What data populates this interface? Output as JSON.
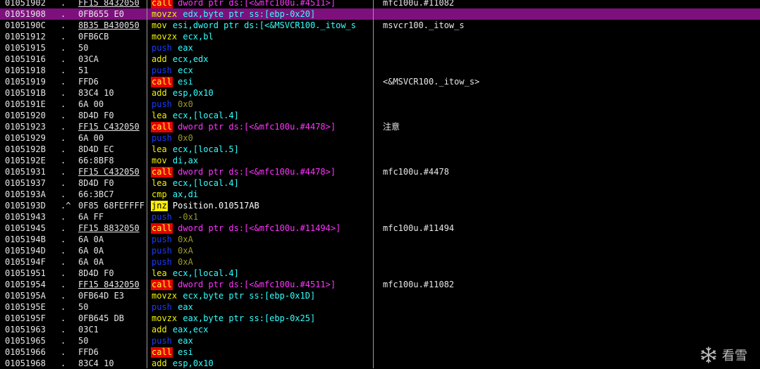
{
  "colors": {
    "background": "#000000",
    "selection": "#7e107e",
    "call_bg": "#e80000",
    "jmp_bg": "#ffee00",
    "push": "#1a3cff",
    "call_operand": "#ff33ff",
    "register_operand": "#33ffff"
  },
  "watermark": {
    "text": "看雪",
    "icon": "snowflake-icon"
  },
  "rows": [
    {
      "addr": "01051902",
      "mark": ".",
      "hex": "FF15 8432050",
      "hex_u": true,
      "mn": "call",
      "op": "dword ptr ds:[<&mfc100u.#4511>]",
      "mtype": "call",
      "otype": "call",
      "cmt": "mfc100u.#11082"
    },
    {
      "addr": "01051908",
      "mark": ".",
      "hex": "0FB655 E0",
      "hex_u": false,
      "mn": "movzx",
      "op": "edx,byte ptr ss:[ebp-0x20]",
      "mtype": "mov",
      "otype": "reg",
      "cmt": "",
      "selected": true
    },
    {
      "addr": "0105190C",
      "mark": ".",
      "hex": "8B35 B430050",
      "hex_u": true,
      "mn": "mov",
      "op": "esi,dword ptr ds:[<&MSVCR100._itow_s",
      "mtype": "mov",
      "otype": "reg",
      "cmt": "msvcr100._itow_s"
    },
    {
      "addr": "01051912",
      "mark": ".",
      "hex": "0FB6CB",
      "hex_u": false,
      "mn": "movzx",
      "op": "ecx,bl",
      "mtype": "mov",
      "otype": "reg",
      "cmt": ""
    },
    {
      "addr": "01051915",
      "mark": ".",
      "hex": "50",
      "hex_u": false,
      "mn": "push",
      "op": "eax",
      "mtype": "push",
      "otype": "reg",
      "cmt": ""
    },
    {
      "addr": "01051916",
      "mark": ".",
      "hex": "03CA",
      "hex_u": false,
      "mn": "add",
      "op": "ecx,edx",
      "mtype": "add",
      "otype": "reg",
      "cmt": ""
    },
    {
      "addr": "01051918",
      "mark": ".",
      "hex": "51",
      "hex_u": false,
      "mn": "push",
      "op": "ecx",
      "mtype": "push",
      "otype": "reg",
      "cmt": ""
    },
    {
      "addr": "01051919",
      "mark": ".",
      "hex": "FFD6",
      "hex_u": false,
      "mn": "call",
      "op": "esi",
      "mtype": "call",
      "otype": "reg",
      "cmt": "<&MSVCR100._itow_s>"
    },
    {
      "addr": "0105191B",
      "mark": ".",
      "hex": "83C4 10",
      "hex_u": false,
      "mn": "add",
      "op": "esp,0x10",
      "mtype": "add",
      "otype": "reg",
      "cmt": ""
    },
    {
      "addr": "0105191E",
      "mark": ".",
      "hex": "6A 00",
      "hex_u": false,
      "mn": "push",
      "op": "0x0",
      "mtype": "push",
      "otype": "num",
      "cmt": ""
    },
    {
      "addr": "01051920",
      "mark": ".",
      "hex": "8D4D F0",
      "hex_u": false,
      "mn": "lea",
      "op": "ecx,[local.4]",
      "mtype": "lea",
      "otype": "reg",
      "cmt": ""
    },
    {
      "addr": "01051923",
      "mark": ".",
      "hex": "FF15 C432050",
      "hex_u": true,
      "mn": "call",
      "op": "dword ptr ds:[<&mfc100u.#4478>]",
      "mtype": "call",
      "otype": "call",
      "cmt": "注意"
    },
    {
      "addr": "01051929",
      "mark": ".",
      "hex": "6A 00",
      "hex_u": false,
      "mn": "push",
      "op": "0x0",
      "mtype": "push",
      "otype": "num",
      "cmt": ""
    },
    {
      "addr": "0105192B",
      "mark": ".",
      "hex": "8D4D EC",
      "hex_u": false,
      "mn": "lea",
      "op": "ecx,[local.5]",
      "mtype": "lea",
      "otype": "reg",
      "cmt": ""
    },
    {
      "addr": "0105192E",
      "mark": ".",
      "hex": "66:8BF8",
      "hex_u": false,
      "mn": "mov",
      "op": "di,ax",
      "mtype": "mov",
      "otype": "reg",
      "cmt": ""
    },
    {
      "addr": "01051931",
      "mark": ".",
      "hex": "FF15 C432050",
      "hex_u": true,
      "mn": "call",
      "op": "dword ptr ds:[<&mfc100u.#4478>]",
      "mtype": "call",
      "otype": "call",
      "cmt": "mfc100u.#4478"
    },
    {
      "addr": "01051937",
      "mark": ".",
      "hex": "8D4D F0",
      "hex_u": false,
      "mn": "lea",
      "op": "ecx,[local.4]",
      "mtype": "lea",
      "otype": "reg",
      "cmt": ""
    },
    {
      "addr": "0105193A",
      "mark": ".",
      "hex": "66:3BC7",
      "hex_u": false,
      "mn": "cmp",
      "op": "ax,di",
      "mtype": "cmp",
      "otype": "reg",
      "cmt": ""
    },
    {
      "addr": "0105193D",
      "mark": ".^",
      "hex": "0F85 68FEFFFF",
      "hex_u": false,
      "mn": "jnz",
      "op": "Position.010517AB",
      "mtype": "jmp",
      "otype": "jmp",
      "cmt": ""
    },
    {
      "addr": "01051943",
      "mark": ".",
      "hex": "6A FF",
      "hex_u": false,
      "mn": "push",
      "op": "-0x1",
      "mtype": "push",
      "otype": "num",
      "cmt": ""
    },
    {
      "addr": "01051945",
      "mark": ".",
      "hex": "FF15 8832050",
      "hex_u": true,
      "mn": "call",
      "op": "dword ptr ds:[<&mfc100u.#11494>]",
      "mtype": "call",
      "otype": "call",
      "cmt": "mfc100u.#11494"
    },
    {
      "addr": "0105194B",
      "mark": ".",
      "hex": "6A 0A",
      "hex_u": false,
      "mn": "push",
      "op": "0xA",
      "mtype": "push",
      "otype": "num",
      "cmt": ""
    },
    {
      "addr": "0105194D",
      "mark": ".",
      "hex": "6A 0A",
      "hex_u": false,
      "mn": "push",
      "op": "0xA",
      "mtype": "push",
      "otype": "num",
      "cmt": ""
    },
    {
      "addr": "0105194F",
      "mark": ".",
      "hex": "6A 0A",
      "hex_u": false,
      "mn": "push",
      "op": "0xA",
      "mtype": "push",
      "otype": "num",
      "cmt": ""
    },
    {
      "addr": "01051951",
      "mark": ".",
      "hex": "8D4D F0",
      "hex_u": false,
      "mn": "lea",
      "op": "ecx,[local.4]",
      "mtype": "lea",
      "otype": "reg",
      "cmt": ""
    },
    {
      "addr": "01051954",
      "mark": ".",
      "hex": "FF15 8432050",
      "hex_u": true,
      "mn": "call",
      "op": "dword ptr ds:[<&mfc100u.#4511>]",
      "mtype": "call",
      "otype": "call",
      "cmt": "mfc100u.#11082"
    },
    {
      "addr": "0105195A",
      "mark": ".",
      "hex": "0FB64D E3",
      "hex_u": false,
      "mn": "movzx",
      "op": "ecx,byte ptr ss:[ebp-0x1D]",
      "mtype": "mov",
      "otype": "reg",
      "cmt": ""
    },
    {
      "addr": "0105195E",
      "mark": ".",
      "hex": "50",
      "hex_u": false,
      "mn": "push",
      "op": "eax",
      "mtype": "push",
      "otype": "reg",
      "cmt": ""
    },
    {
      "addr": "0105195F",
      "mark": ".",
      "hex": "0FB645 DB",
      "hex_u": false,
      "mn": "movzx",
      "op": "eax,byte ptr ss:[ebp-0x25]",
      "mtype": "mov",
      "otype": "reg",
      "cmt": ""
    },
    {
      "addr": "01051963",
      "mark": ".",
      "hex": "03C1",
      "hex_u": false,
      "mn": "add",
      "op": "eax,ecx",
      "mtype": "add",
      "otype": "reg",
      "cmt": ""
    },
    {
      "addr": "01051965",
      "mark": ".",
      "hex": "50",
      "hex_u": false,
      "mn": "push",
      "op": "eax",
      "mtype": "push",
      "otype": "reg",
      "cmt": ""
    },
    {
      "addr": "01051966",
      "mark": ".",
      "hex": "FFD6",
      "hex_u": false,
      "mn": "call",
      "op": "esi",
      "mtype": "call",
      "otype": "reg",
      "cmt": ""
    },
    {
      "addr": "01051968",
      "mark": ".",
      "hex": "83C4 10",
      "hex_u": false,
      "mn": "add",
      "op": "esp,0x10",
      "mtype": "add",
      "otype": "reg",
      "cmt": ""
    }
  ]
}
